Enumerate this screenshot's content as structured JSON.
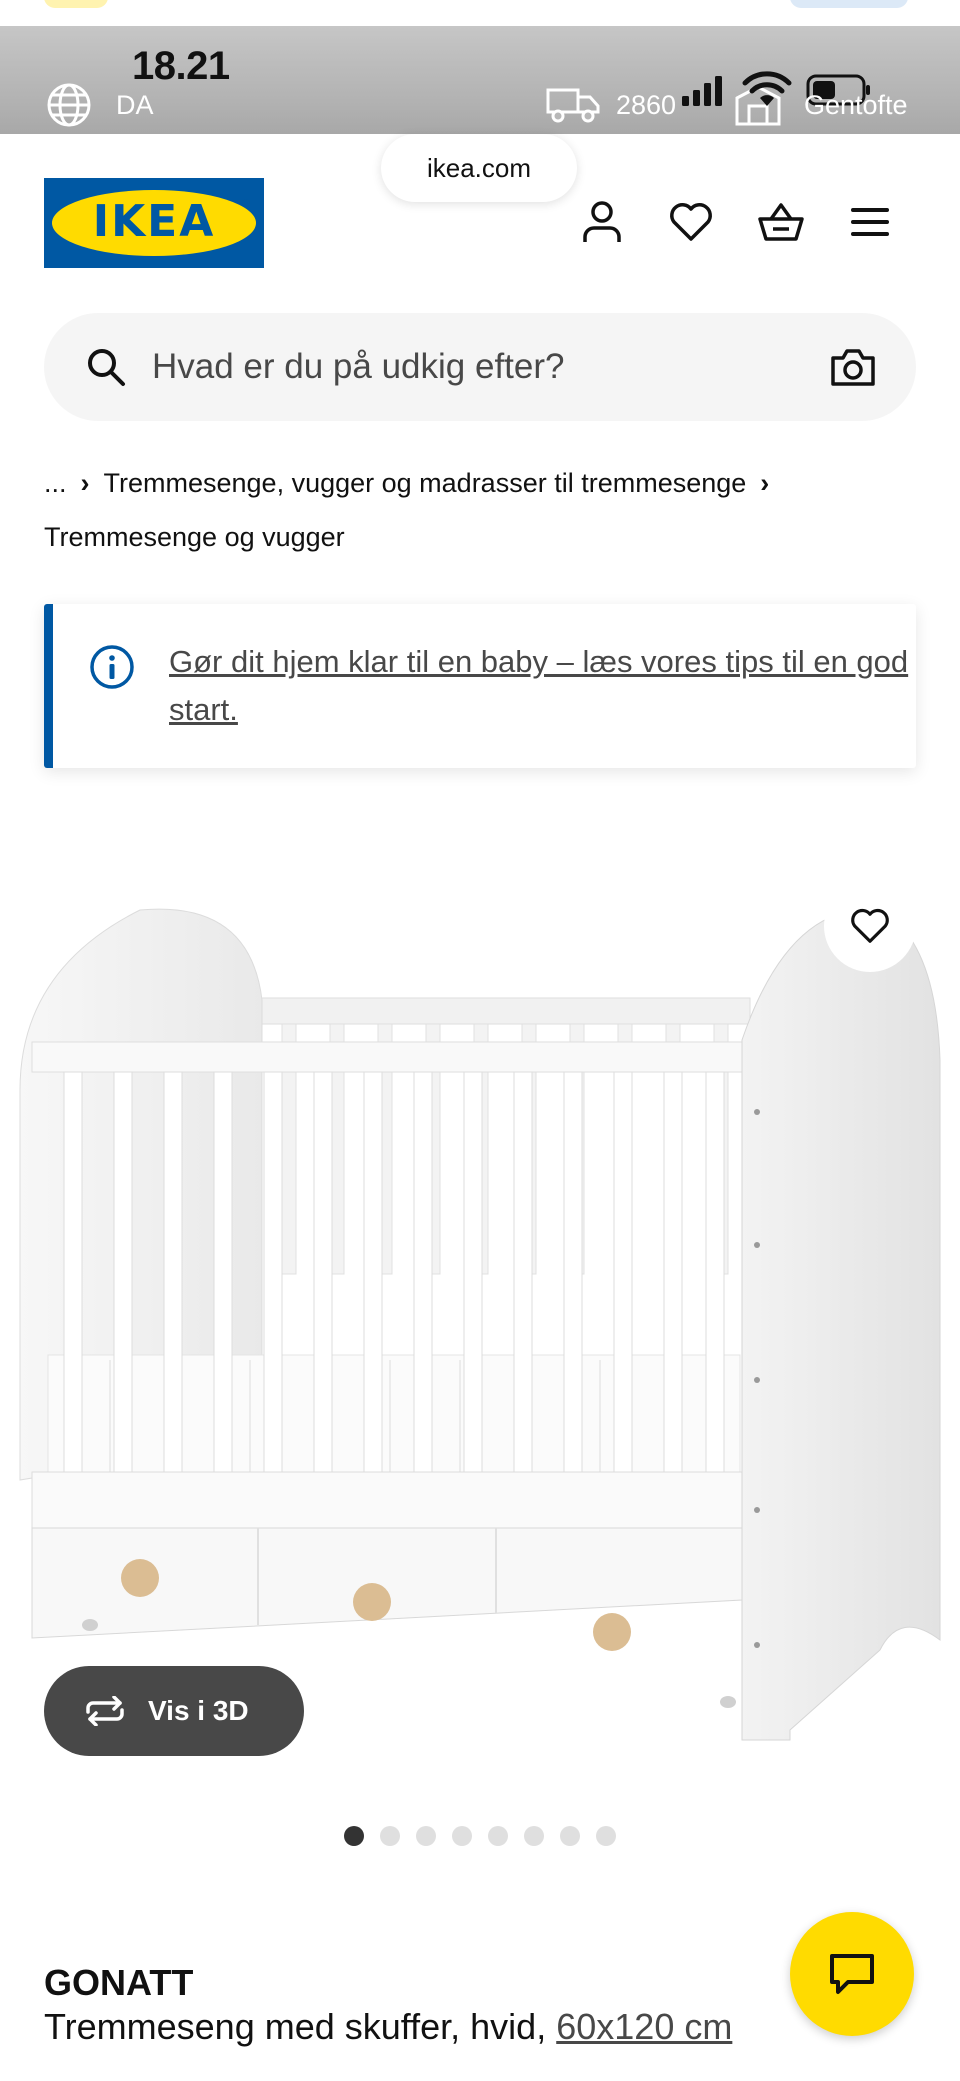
{
  "status_bar": {
    "time": "18.21",
    "language": "DA",
    "postal_code": "2860",
    "store": "Gentofte"
  },
  "browser": {
    "url": "ikea.com"
  },
  "header": {
    "logo_text": "IKEA"
  },
  "search": {
    "placeholder": "Hvad er du på udkig efter?"
  },
  "breadcrumb": {
    "ellipsis": "...",
    "category": "Tremmesenge, vugger og madrasser til tremmesenge",
    "current": "Tremmesenge og vugger"
  },
  "info_banner": {
    "text": "Gør dit hjem klar til en baby – læs vores tips til en god start."
  },
  "gallery": {
    "view_3d_label": "Vis i 3D",
    "image_count": 8,
    "active_index": 0
  },
  "product": {
    "name": "GONATT",
    "description": "Tremmeseng med skuffer, hvid,",
    "size": "60x120 cm"
  },
  "colors": {
    "ikea_blue": "#0058a3",
    "ikea_yellow": "#ffdb00",
    "dark_grey": "#484848"
  }
}
